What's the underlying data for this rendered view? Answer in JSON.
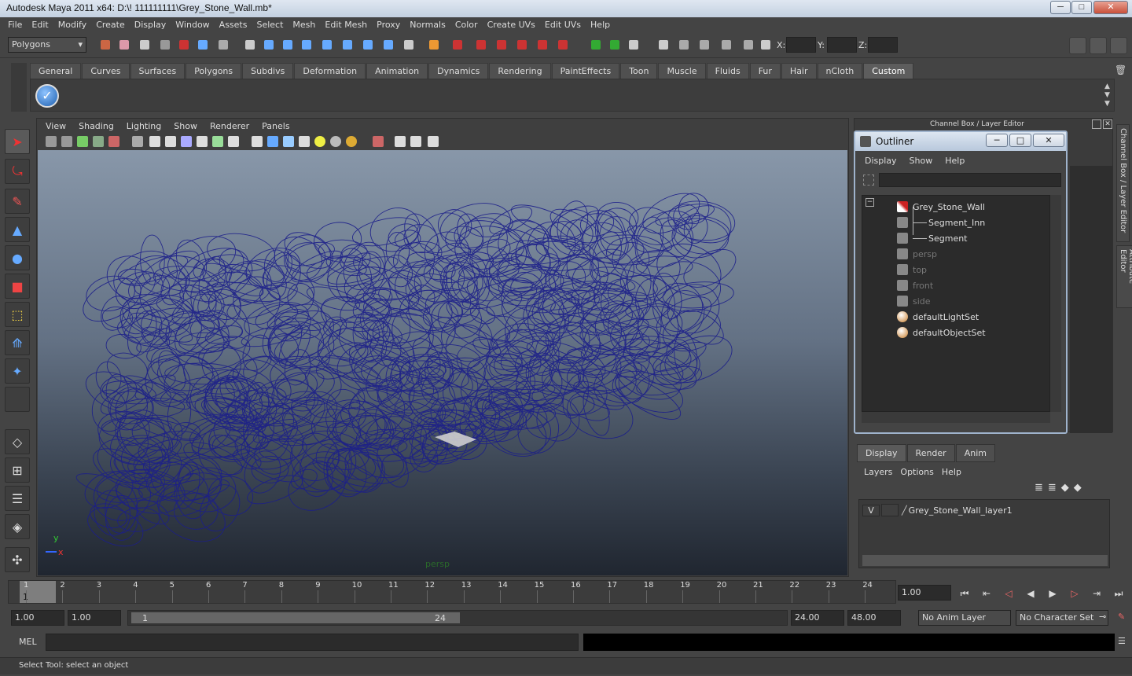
{
  "window": {
    "title": "Autodesk Maya 2011 x64: D:\\! 111111111\\Grey_Stone_Wall.mb*",
    "minimize": "─",
    "maximize": "□",
    "close": "✕"
  },
  "menubar": [
    "File",
    "Edit",
    "Modify",
    "Create",
    "Display",
    "Window",
    "Assets",
    "Select",
    "Mesh",
    "Edit Mesh",
    "Proxy",
    "Normals",
    "Color",
    "Create UVs",
    "Edit UVs",
    "Help"
  ],
  "statusline": {
    "menuset": "Polygons",
    "x_label": "X:",
    "y_label": "Y:",
    "z_label": "Z:",
    "x_value": "",
    "y_value": "",
    "z_value": ""
  },
  "shelf": {
    "tabs": [
      "General",
      "Curves",
      "Surfaces",
      "Polygons",
      "Subdivs",
      "Deformation",
      "Animation",
      "Dynamics",
      "Rendering",
      "PaintEffects",
      "Toon",
      "Muscle",
      "Fluids",
      "Fur",
      "Hair",
      "nCloth",
      "Custom"
    ],
    "active": "Custom"
  },
  "panel": {
    "menus": [
      "View",
      "Shading",
      "Lighting",
      "Show",
      "Renderer",
      "Panels"
    ],
    "camera_label": "persp",
    "axis_x": "x",
    "axis_y": "y"
  },
  "channelbox": {
    "title": "Channel Box / Layer Editor",
    "vtab_channel": "Channel Box / Layer Editor",
    "vtab_attr": "Attribute Editor"
  },
  "outliner": {
    "title": "Outliner",
    "menus": [
      "Display",
      "Show",
      "Help"
    ],
    "filter": "",
    "items": [
      {
        "label": "Grey_Stone_Wall",
        "icon": "transform-icon",
        "dim": false
      },
      {
        "label": "Segment_Inn",
        "icon": "mesh-icon",
        "dim": false
      },
      {
        "label": "Segment",
        "icon": "mesh-icon",
        "dim": false
      },
      {
        "label": "persp",
        "icon": "camera-icon",
        "dim": true
      },
      {
        "label": "top",
        "icon": "camera-icon",
        "dim": true
      },
      {
        "label": "front",
        "icon": "camera-icon",
        "dim": true
      },
      {
        "label": "side",
        "icon": "camera-icon",
        "dim": true
      },
      {
        "label": "defaultLightSet",
        "icon": "set-icon",
        "dim": false
      },
      {
        "label": "defaultObjectSet",
        "icon": "set-icon",
        "dim": false
      }
    ],
    "collapse": "−"
  },
  "layers": {
    "tabs": [
      "Display",
      "Render",
      "Anim"
    ],
    "active": "Display",
    "menus": [
      "Layers",
      "Options",
      "Help"
    ],
    "layer": {
      "visible": "V",
      "name": "Grey_Stone_Wall_layer1"
    }
  },
  "timeline": {
    "ticks": [
      "1",
      "2",
      "3",
      "4",
      "5",
      "6",
      "7",
      "8",
      "9",
      "10",
      "11",
      "12",
      "13",
      "14",
      "15",
      "16",
      "17",
      "18",
      "19",
      "20",
      "21",
      "22",
      "23",
      "24"
    ],
    "current_frame": "1",
    "current_field": "1.00"
  },
  "range": {
    "start": "1.00",
    "current": "1.00",
    "slider_start": "1",
    "slider_end": "24",
    "end": "24.00",
    "max": "48.00",
    "anim_layer": "No Anim Layer",
    "character_set": "No Character Set"
  },
  "cmdline": {
    "label": "MEL",
    "value": ""
  },
  "helpline": {
    "text": "Select Tool: select an object"
  },
  "colors": {
    "wire": "#1c1f8a",
    "accent": "#9fb3cc"
  }
}
